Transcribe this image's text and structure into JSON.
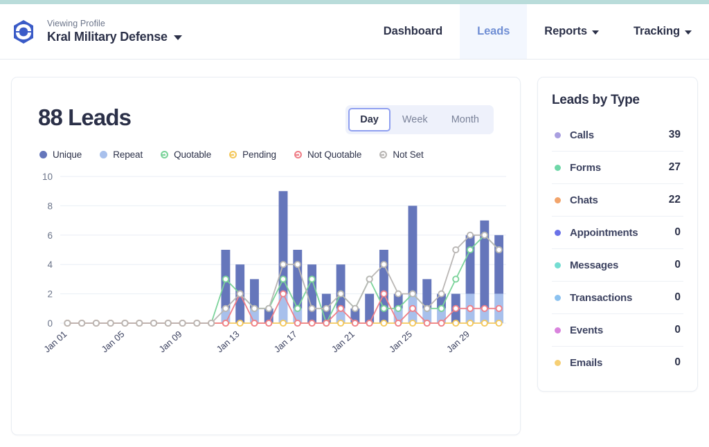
{
  "header": {
    "logo_icon": "hexagon-logo-icon",
    "viewing_label": "Viewing Profile",
    "profile_name": "Kral Military Defense",
    "profile_caret_icon": "chevron-down-icon",
    "nav": [
      {
        "label": "Dashboard",
        "active": false,
        "has_caret": false
      },
      {
        "label": "Leads",
        "active": true,
        "has_caret": false
      },
      {
        "label": "Reports",
        "active": false,
        "has_caret": true
      },
      {
        "label": "Tracking",
        "active": false,
        "has_caret": true
      }
    ]
  },
  "chart_card": {
    "title": "88 Leads",
    "range_toggle": {
      "options": [
        "Day",
        "Week",
        "Month"
      ],
      "selected": "Day"
    }
  },
  "sidebar": {
    "title": "Leads by Type",
    "items": [
      {
        "label": "Calls",
        "count": "39",
        "color": "#a99fe0"
      },
      {
        "label": "Forms",
        "count": "27",
        "color": "#6fd7a8"
      },
      {
        "label": "Chats",
        "count": "22",
        "color": "#f2a46b"
      },
      {
        "label": "Appointments",
        "count": "0",
        "color": "#6a72e8"
      },
      {
        "label": "Messages",
        "count": "0",
        "color": "#74ddd2"
      },
      {
        "label": "Transactions",
        "count": "0",
        "color": "#8cc2f0"
      },
      {
        "label": "Events",
        "count": "0",
        "color": "#d983dd"
      },
      {
        "label": "Emails",
        "count": "0",
        "color": "#f6cf74"
      }
    ]
  },
  "chart_data": {
    "type": "bar",
    "title": "88 Leads",
    "xlabel": "",
    "ylabel": "",
    "ylim": [
      0,
      10
    ],
    "yticks": [
      0,
      2,
      4,
      6,
      8,
      10
    ],
    "grid": true,
    "legend_position": "top-left",
    "categories": [
      "Jan 01",
      "Jan 02",
      "Jan 03",
      "Jan 04",
      "Jan 05",
      "Jan 06",
      "Jan 07",
      "Jan 08",
      "Jan 09",
      "Jan 10",
      "Jan 11",
      "Jan 12",
      "Jan 13",
      "Jan 14",
      "Jan 15",
      "Jan 16",
      "Jan 17",
      "Jan 18",
      "Jan 19",
      "Jan 20",
      "Jan 21",
      "Jan 22",
      "Jan 23",
      "Jan 24",
      "Jan 25",
      "Jan 26",
      "Jan 27",
      "Jan 28",
      "Jan 29",
      "Jan 30",
      "Jan 31"
    ],
    "tick_labels": [
      "Jan 01",
      "Jan 05",
      "Jan 09",
      "Jan 13",
      "Jan 17",
      "Jan 21",
      "Jan 25",
      "Jan 29"
    ],
    "tick_interval": 4,
    "series": [
      {
        "name": "Unique",
        "kind": "bar-stack",
        "color": "#6576bb",
        "values": [
          0,
          0,
          0,
          0,
          0,
          0,
          0,
          0,
          0,
          0,
          0,
          4,
          4,
          2,
          1,
          7,
          4,
          4,
          2,
          3,
          1,
          2,
          5,
          1,
          6,
          2,
          1,
          2,
          4,
          6,
          4
        ]
      },
      {
        "name": "Repeat",
        "kind": "bar-stack",
        "color": "#a8c0ec",
        "values": [
          0,
          0,
          0,
          0,
          0,
          0,
          0,
          0,
          0,
          0,
          0,
          1,
          0,
          1,
          0,
          2,
          1,
          0,
          0,
          1,
          0,
          0,
          0,
          1,
          2,
          1,
          1,
          0,
          2,
          1,
          2
        ]
      },
      {
        "name": "Quotable",
        "kind": "line",
        "color": "#7bd39a",
        "values": [
          0,
          0,
          0,
          0,
          0,
          0,
          0,
          0,
          0,
          0,
          0,
          3,
          2,
          1,
          1,
          3,
          1,
          3,
          0,
          2,
          1,
          3,
          1,
          1,
          2,
          1,
          1,
          3,
          5,
          6,
          5
        ]
      },
      {
        "name": "Pending",
        "kind": "line",
        "color": "#f4c85c",
        "values": [
          0,
          0,
          0,
          0,
          0,
          0,
          0,
          0,
          0,
          0,
          0,
          0,
          0,
          0,
          0,
          0,
          0,
          0,
          0,
          0,
          0,
          0,
          0,
          0,
          0,
          0,
          0,
          0,
          0,
          0,
          0
        ]
      },
      {
        "name": "Not Quotable",
        "kind": "line",
        "color": "#ef7f88",
        "values": [
          0,
          0,
          0,
          0,
          0,
          0,
          0,
          0,
          0,
          0,
          0,
          0,
          2,
          0,
          0,
          2,
          0,
          0,
          0,
          1,
          0,
          0,
          2,
          0,
          1,
          0,
          0,
          1,
          1,
          1,
          1
        ]
      },
      {
        "name": "Not Set",
        "kind": "line",
        "color": "#b9b6b4",
        "values": [
          0,
          0,
          0,
          0,
          0,
          0,
          0,
          0,
          0,
          0,
          0,
          1,
          2,
          1,
          1,
          4,
          4,
          1,
          1,
          2,
          1,
          3,
          4,
          2,
          2,
          1,
          2,
          5,
          6,
          6,
          5
        ]
      }
    ]
  }
}
